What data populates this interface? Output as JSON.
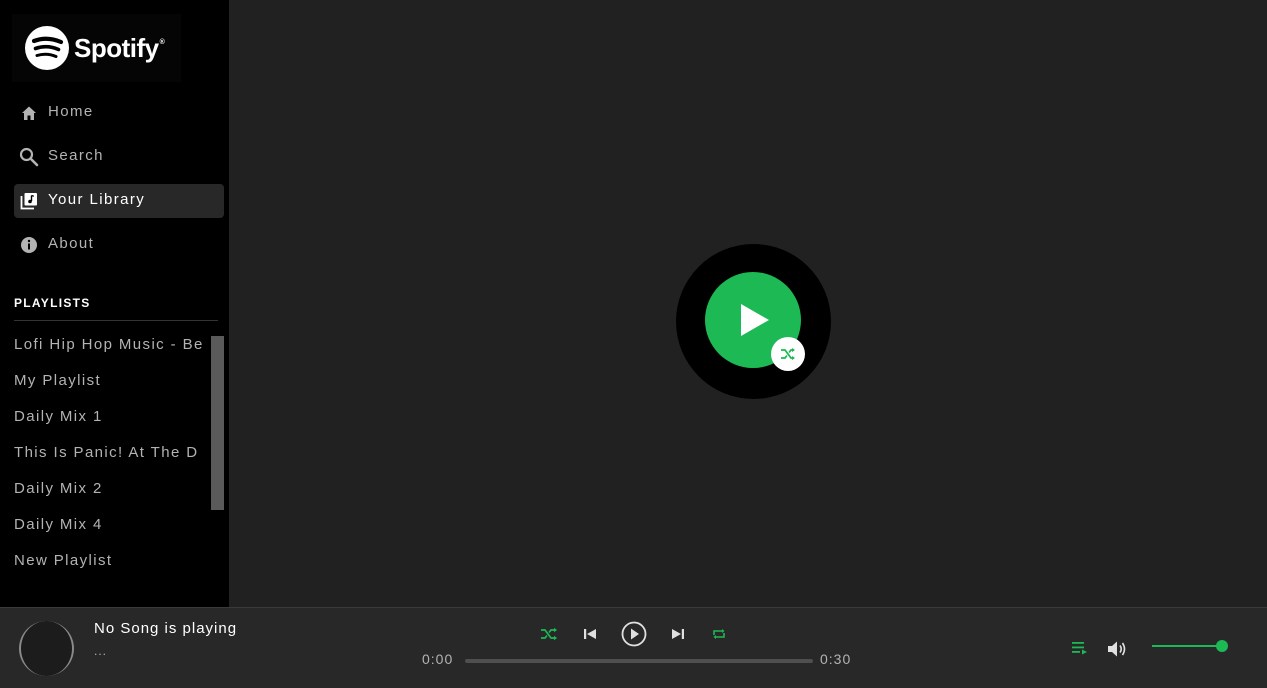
{
  "brand": {
    "name": "Spotify",
    "mark": "®"
  },
  "nav": [
    {
      "label": "Home",
      "icon": "home-icon",
      "active": false
    },
    {
      "label": "Search",
      "icon": "search-icon",
      "active": false
    },
    {
      "label": "Your Library",
      "icon": "library-icon",
      "active": true
    },
    {
      "label": "About",
      "icon": "info-icon",
      "active": false
    }
  ],
  "playlists": {
    "heading": "PLAYLISTS",
    "items": [
      "Lofi Hip Hop Music - Be",
      "My Playlist",
      "Daily Mix 1",
      "This Is Panic! At The D",
      "Daily Mix 2",
      "Daily Mix 4",
      "New Playlist"
    ]
  },
  "player": {
    "title": "No Song is playing",
    "artist": "...",
    "time_current": "0:00",
    "time_total": "0:30",
    "progress": 0,
    "volume": 1.0
  },
  "colors": {
    "accent": "#1db954",
    "sidebar_bg": "#000000",
    "main_bg": "#212121",
    "player_bg": "#282828",
    "text_muted": "#b3b3b3"
  }
}
